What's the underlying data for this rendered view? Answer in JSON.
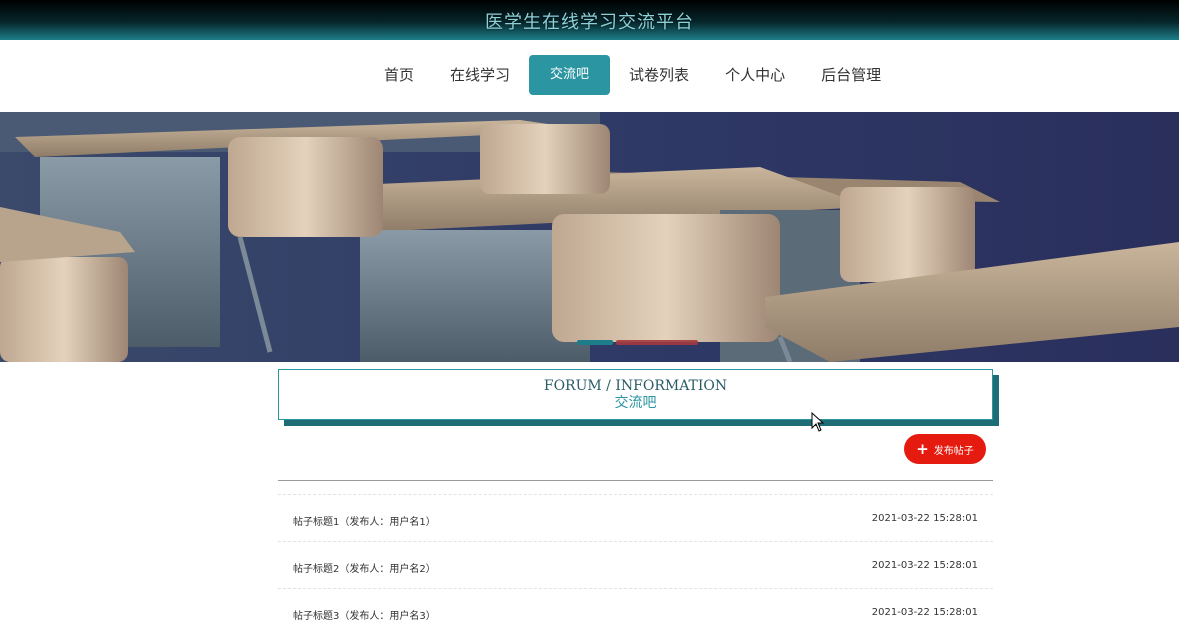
{
  "header": {
    "site_title": "医学生在线学习交流平台"
  },
  "nav": {
    "items": [
      {
        "label": "首页",
        "active": false
      },
      {
        "label": "在线学习",
        "active": false
      },
      {
        "label": "交流吧",
        "active": true
      },
      {
        "label": "试卷列表",
        "active": false
      },
      {
        "label": "个人中心",
        "active": false
      },
      {
        "label": "后台管理",
        "active": false
      }
    ]
  },
  "banner": {
    "image": "classroom-desks-illustration",
    "slide_count": 2,
    "active_slide": 1
  },
  "section": {
    "title_en": "FORUM / INFORMATION",
    "title_cn": "交流吧"
  },
  "actions": {
    "post_button_label": "发布帖子",
    "post_button_icon": "plus-icon",
    "post_button_color": "#e51b0f"
  },
  "posts": [
    {
      "title": "帖子标题1（发布人：用户名1）",
      "time": "2021-03-22 15:28:01"
    },
    {
      "title": "帖子标题2（发布人：用户名2）",
      "time": "2021-03-22 15:28:01"
    },
    {
      "title": "帖子标题3（发布人：用户名3）",
      "time": "2021-03-22 15:28:01"
    }
  ],
  "colors": {
    "accent": "#2b95a2",
    "header_dark": "#000000"
  }
}
